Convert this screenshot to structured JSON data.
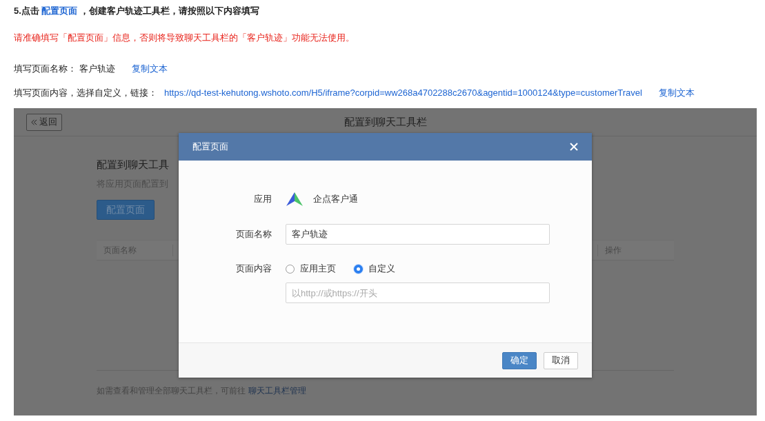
{
  "instructions": {
    "step": {
      "prefix": "5.点击",
      "link": "配置页面",
      "suffix": "，创建客户轨迹工具栏，请按照以下内容填写"
    },
    "warning": "请准确填写「配置页面」信息，否则将导致聊天工具栏的「客户轨迹」功能无法使用。",
    "fields": [
      {
        "label": "填写页面名称：",
        "kind": "text",
        "value": "客户轨迹",
        "copy": "复制文本"
      },
      {
        "label": "填写页面内容，选择自定义，链接：",
        "kind": "link",
        "value": "https://qd-test-kehutong.wshoto.com/H5/iframe?corpid=ww268a4702288c2670&agentid=1000124&type=customerTravel",
        "copy": "复制文本"
      }
    ]
  },
  "background_page": {
    "back_button": "返回",
    "title": "配置到聊天工具栏",
    "heading": "配置到聊天工具",
    "subtitle": "将应用页面配置到",
    "action_button": "配置页面",
    "table_columns": [
      "页面名称",
      "操作"
    ],
    "footer": {
      "text": "如需查看和管理全部聊天工具栏，可前往",
      "link": "聊天工具栏管理"
    }
  },
  "dialog": {
    "title": "配置页面",
    "rows": [
      {
        "kind": "app",
        "label": "应用",
        "value": "企点客户通"
      },
      {
        "kind": "input",
        "label": "页面名称",
        "value": "客户轨迹"
      },
      {
        "kind": "radio",
        "label": "页面内容",
        "options": [
          {
            "label": "应用主页",
            "selected": false
          },
          {
            "label": "自定义",
            "selected": true
          }
        ]
      },
      {
        "kind": "input",
        "placeholder": "以http://或https://开头"
      }
    ],
    "buttons": [
      {
        "label": "确定",
        "primary": true
      },
      {
        "label": "取消",
        "primary": false
      }
    ]
  }
}
